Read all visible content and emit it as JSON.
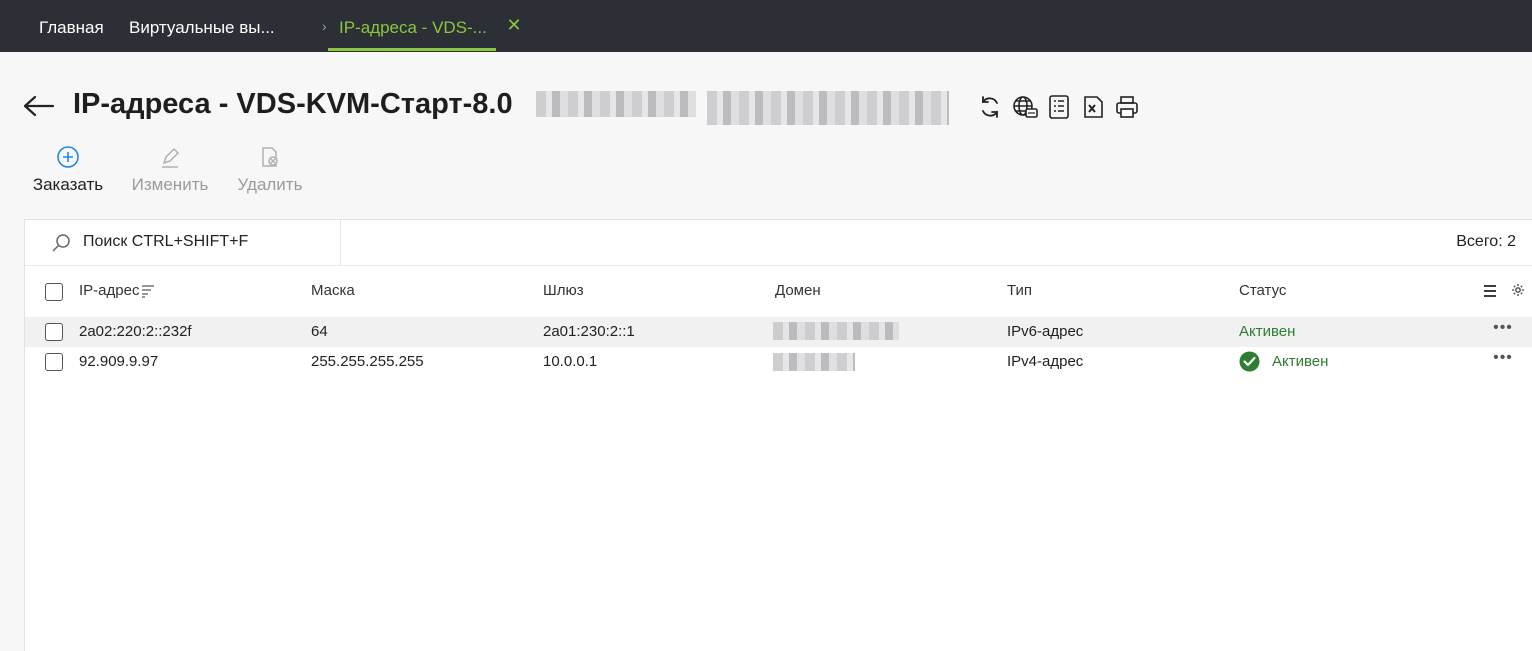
{
  "tabs": {
    "home": "Главная",
    "vm": "Виртуальные вы...",
    "active": "IP-адреса - VDS-...",
    "separator": "›",
    "close": "✕"
  },
  "page": {
    "title": "IP-адреса - VDS-KVM-Старт-8.0",
    "title_icons": [
      "refresh-icon",
      "dns-globe-icon",
      "list-report-icon",
      "excel-export-icon",
      "print-icon"
    ]
  },
  "toolbar": {
    "order_label": "Заказать",
    "edit_label": "Изменить",
    "delete_label": "Удалить"
  },
  "search": {
    "placeholder": "Поиск CTRL+SHIFT+F"
  },
  "total": "Всего: 2",
  "table": {
    "columns": [
      "IP-адрес",
      "Маска",
      "Шлюз",
      "Домен",
      "Тип",
      "Статус"
    ],
    "rows": [
      {
        "ip": "2a02:220:2::232f",
        "mask": "64",
        "gateway": "2a01:230:2::1",
        "domain": "",
        "type": "IPv6-адрес",
        "status": "Активен"
      },
      {
        "ip": "92.909.9.97",
        "mask": "255.255.255.255",
        "gateway": "10.0.0.1",
        "domain": "",
        "type": "IPv4-адрес",
        "status": "Активен"
      }
    ]
  },
  "colors": {
    "topbar_bg": "#2c2f36",
    "accent_green": "#8dc63f",
    "status_green": "#2e7d32",
    "link_blue": "#1e88e5"
  }
}
